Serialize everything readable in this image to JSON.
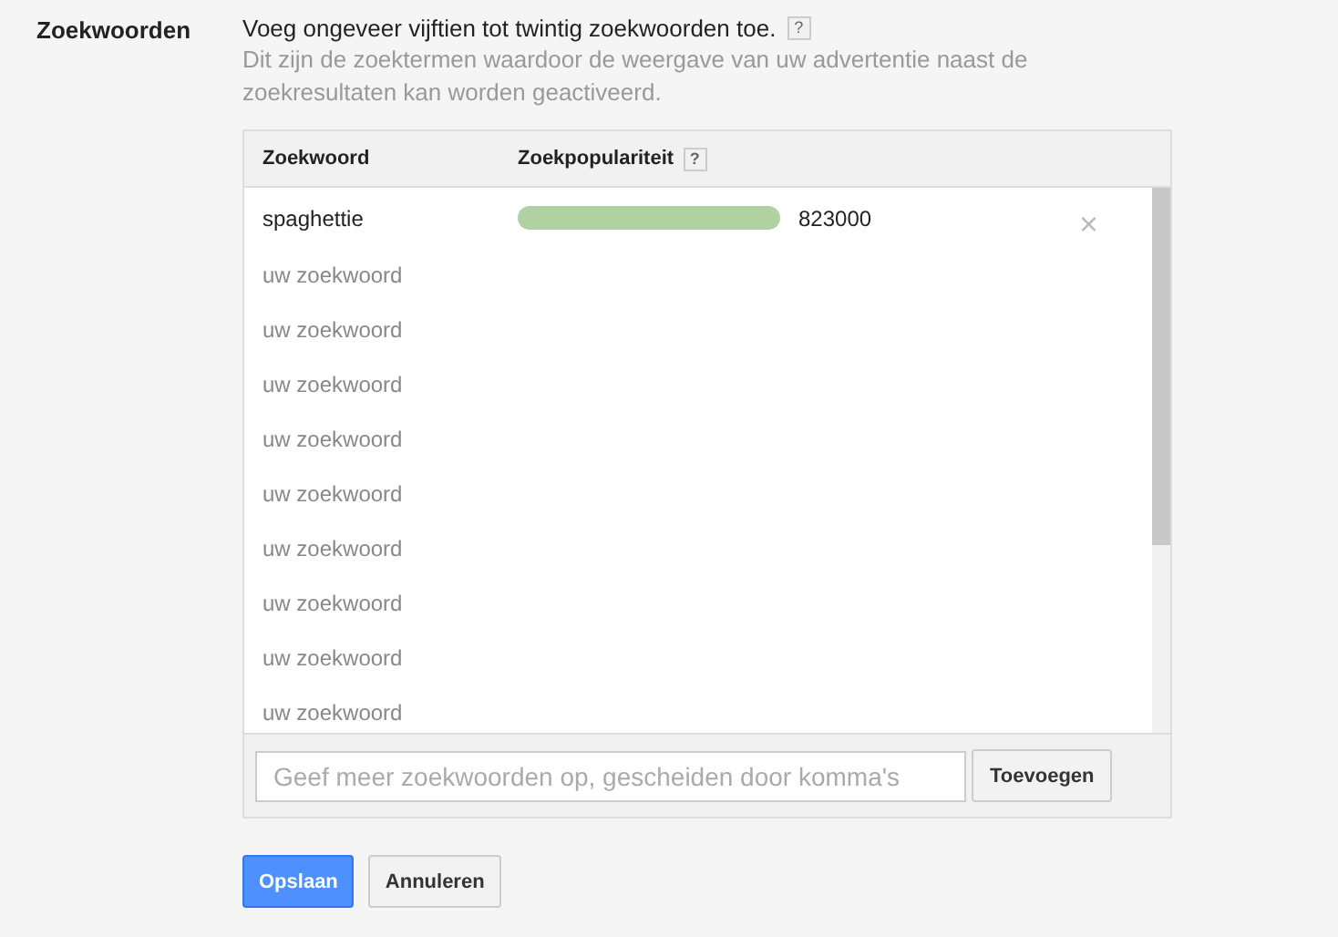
{
  "section_label": "Zoekwoorden",
  "instruction": "Voeg ongeveer vijftien tot twintig zoekwoorden toe.",
  "help_mark": "?",
  "description": "Dit zijn de zoektermen waardoor de weergave van uw advertentie naast de zoekresultaten kan worden geactiveerd.",
  "table": {
    "columns": [
      {
        "label": "Zoekwoord"
      },
      {
        "label": "Zoekpopulariteit",
        "help": "?"
      }
    ],
    "rows": [
      {
        "kind": "keyword",
        "keyword": "spaghettie",
        "count": "823000",
        "remove": "×"
      },
      {
        "kind": "empty",
        "placeholder": "uw zoekwoord"
      },
      {
        "kind": "empty",
        "placeholder": "uw zoekwoord"
      },
      {
        "kind": "empty",
        "placeholder": "uw zoekwoord"
      },
      {
        "kind": "empty",
        "placeholder": "uw zoekwoord"
      },
      {
        "kind": "empty",
        "placeholder": "uw zoekwoord"
      },
      {
        "kind": "empty",
        "placeholder": "uw zoekwoord"
      },
      {
        "kind": "empty",
        "placeholder": "uw zoekwoord"
      },
      {
        "kind": "empty",
        "placeholder": "uw zoekwoord"
      },
      {
        "kind": "empty",
        "placeholder": "uw zoekwoord"
      }
    ],
    "add_field": {
      "placeholder": "Geef meer zoekwoorden op, gescheiden door komma's"
    },
    "add_button": "Toevoegen"
  },
  "buttons": [
    {
      "label": "Opslaan",
      "primary": true
    },
    {
      "label": "Annuleren",
      "primary": false
    }
  ]
}
